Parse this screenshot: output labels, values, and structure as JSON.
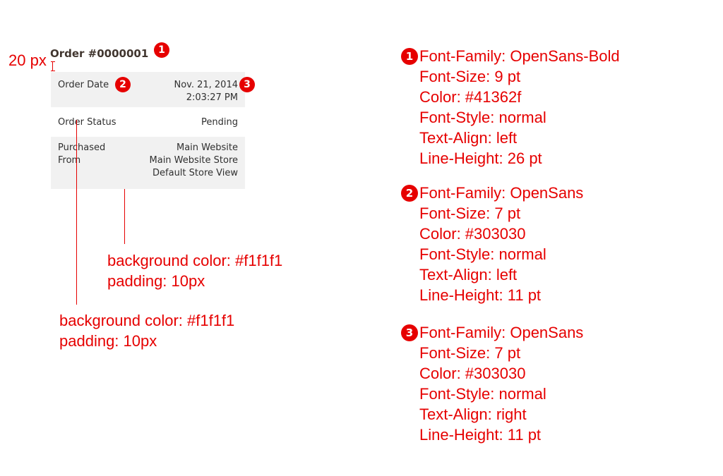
{
  "order": {
    "title": "Order #0000001",
    "date_label": "Order Date",
    "date_value_line1": "Nov. 21, 2014",
    "date_value_line2": "2:03:27 PM",
    "status_label": "Order Status",
    "status_value": "Pending",
    "purchased_label_line1": "Purchased",
    "purchased_label_line2": "From",
    "purchased_value_line1": "Main Website",
    "purchased_value_line2": "Main Website Store",
    "purchased_value_line3": "Default Store View"
  },
  "annotations": {
    "gap_label": "20 px",
    "note_a_line1": "background color: #f1f1f1",
    "note_a_line2": "padding: 10px",
    "note_b_line1": "background color: #f1f1f1",
    "note_b_line2": "padding: 10px"
  },
  "badges": {
    "one": "1",
    "two": "2",
    "three": "3"
  },
  "specs": [
    {
      "font_family": "Font-Family: OpenSans-Bold",
      "font_size": "Font-Size: 9 pt",
      "color": "Color: #41362f",
      "font_style": "Font-Style: normal",
      "text_align": "Text-Align: left",
      "line_height": "Line-Height: 26 pt"
    },
    {
      "font_family": "Font-Family: OpenSans",
      "font_size": "Font-Size: 7 pt",
      "color": "Color: #303030",
      "font_style": "Font-Style: normal",
      "text_align": "Text-Align: left",
      "line_height": "Line-Height: 11 pt"
    },
    {
      "font_family": "Font-Family: OpenSans",
      "font_size": "Font-Size: 7 pt",
      "color": "Color: #303030",
      "font_style": "Font-Style: normal",
      "text_align": "Text-Align: right",
      "line_height": "Line-Height: 11 pt"
    }
  ],
  "colors": {
    "annotation_red": "#e60000",
    "title_color": "#41362f",
    "body_text": "#303030",
    "panel_bg": "#f1f1f1"
  }
}
